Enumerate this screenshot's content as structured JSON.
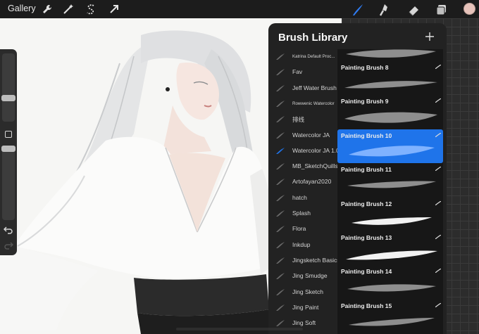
{
  "toolbar": {
    "gallery_label": "Gallery",
    "actions": [
      "wrench-icon",
      "magic-wand-icon",
      "selection-s-icon",
      "transform-arrow-icon"
    ],
    "tools": [
      "brush-icon",
      "smudge-icon",
      "eraser-icon",
      "layers-icon"
    ],
    "current_color": "#e7c3bb",
    "active_tool_color": "#2f7bf0"
  },
  "sidebar": {
    "size_slider_level": 0.26,
    "opacity_slider_level": 0.38,
    "undo_icon": "undo-icon",
    "redo_icon": "redo-icon"
  },
  "brush_library": {
    "title": "Brush Library",
    "add_icon": "plus-icon",
    "sets": [
      {
        "label": "Katrina Default Proc...",
        "tiny": true
      },
      {
        "label": "Fav"
      },
      {
        "label": "Jeff Water Brush"
      },
      {
        "label": "Rowwenic Watercolor",
        "tiny": true
      },
      {
        "label": "排线"
      },
      {
        "label": "Watercolor JA"
      },
      {
        "label": "Watercolor JA 1.0",
        "selected": true
      },
      {
        "label": "MB_SketchQuills"
      },
      {
        "label": "Artofayan2020"
      },
      {
        "label": "hatch"
      },
      {
        "label": "Splash"
      },
      {
        "label": "Flora"
      },
      {
        "label": "Inkdup"
      },
      {
        "label": "Jingsketch Basics"
      },
      {
        "label": "Jing Smudge"
      },
      {
        "label": "Jing Sketch"
      },
      {
        "label": "Jing Paint"
      },
      {
        "label": "Jing Soft"
      }
    ],
    "brushes": [
      {
        "name": "Painting Brush 8"
      },
      {
        "name": "Painting Brush 9"
      },
      {
        "name": "Painting Brush 10",
        "selected": true
      },
      {
        "name": "Painting Brush 11"
      },
      {
        "name": "Painting Brush 12"
      },
      {
        "name": "Painting Brush 13"
      },
      {
        "name": "Painting Brush 14"
      },
      {
        "name": "Painting Brush 15"
      }
    ],
    "accent_color": "#1f74ea"
  }
}
